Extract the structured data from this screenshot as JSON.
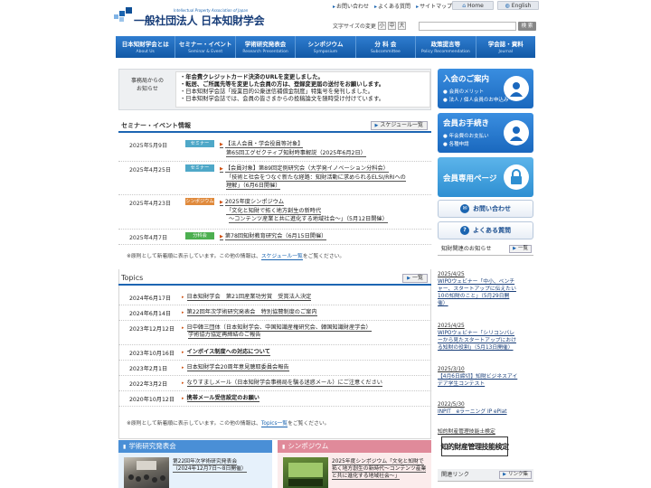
{
  "header": {
    "logo_main": "一般社団法人 日本知財学会",
    "logo_sub": "Intellectual Property Association of Japan",
    "toplinks": [
      "お問い合わせ",
      "よくある質問",
      "サイトマップ"
    ],
    "home_label": "Home",
    "english_label": "English",
    "font_size_label": "文字サイズの変更",
    "font_sizes": [
      "小",
      "中",
      "大"
    ],
    "search_placeholder": "",
    "search_button": "検 索"
  },
  "nav": [
    {
      "jp": "日本知財学会とは",
      "en": "About Us"
    },
    {
      "jp": "セミナー・イベント",
      "en": "Seminar & Event"
    },
    {
      "jp": "学術研究発表会",
      "en": "Research Presentation"
    },
    {
      "jp": "シンポジウム",
      "en": "Symposium"
    },
    {
      "jp": "分 科 会",
      "en": "Subcommittee"
    },
    {
      "jp": "政策提言等",
      "en": "Policy Recommendation"
    },
    {
      "jp": "学会誌・資料",
      "en": "Journal"
    }
  ],
  "notice": {
    "label_line1": "事務局からの",
    "label_line2": "お知らせ",
    "lines": [
      "・年会費クレジットカード決済のURLを変更しました。",
      "・転居、ご所属先等を変更した会員の方は、登録変更届の送付をお願いします。",
      "・日本知財学会誌「授業目的公衆送信補償金制度」特集号を発刊しました。",
      "・日本知財学会誌では、会員の皆さまからの投稿論文を随時受け付けています。"
    ]
  },
  "seminar": {
    "title": "セミナー・イベント情報",
    "list_label": "スケジュール一覧",
    "rows": [
      {
        "date": "2025年5月9日",
        "tag": "セミナー",
        "tag_color": "#4fa8c8",
        "lines": [
          "【法人会員・学会役員等対象】",
          "第65回エグゼクティブ知財時事解説（2025年6月2日）"
        ]
      },
      {
        "date": "2025年4月25日",
        "tag": "セミナー",
        "tag_color": "#4fa8c8",
        "lines": [
          "【会員対象】第89回定例研究会（大学発イノベーション分科会）",
          "「技術と社会をつなぐ新たな経路：知財活動に求められるELSI/RRIへの",
          "理解」（6月6日開催）"
        ]
      },
      {
        "date": "2025年4月23日",
        "tag": "シンポジウム",
        "tag_color": "#e08a3c",
        "lines": [
          "2025年度シンポジウム",
          "「文化と知財で拓く地方創生の新時代",
          "～コンテンツ産業と共に進化する地域社会～」（5月12日開催）"
        ]
      },
      {
        "date": "2025年4月7日",
        "tag": "分科会",
        "tag_color": "#4caf50",
        "lines": [
          "第78回知財教育研究会（6月15日開催）"
        ]
      }
    ],
    "note_pre": "※原則として新着順に表示しています。この他の情報は、",
    "note_link": "スケジュール一覧",
    "note_post": "をご覧ください。"
  },
  "topics": {
    "title": "Topics",
    "list_label": "一覧",
    "rows": [
      {
        "date": "2024年6月17日",
        "lines": [
          "日本知財学会　第21回産業功労賞　受賞法人決定"
        ],
        "bold": false
      },
      {
        "date": "2024年6月14日",
        "lines": [
          "第22回年次学術研究発表会　特別協賛制度のご案内"
        ],
        "bold": false
      },
      {
        "date": "2023年12月12日",
        "lines": [
          "日中韓三団体（日本知財学会、中国知識産権研究会、韓国知識財産学会）",
          "学術協力協定再締結のご報告"
        ],
        "bold": false
      },
      {
        "date": "2023年10月16日",
        "lines": [
          "インボイス制度への対応について"
        ],
        "bold": true
      },
      {
        "date": "2023年2月1日",
        "lines": [
          "日本知財学会20周年意見聴取委員会報告"
        ],
        "bold": false
      },
      {
        "date": "2022年3月2日",
        "lines": [
          "なりすましメール（日本知財学会事務局を騙る迷惑メール）にご注意ください"
        ],
        "bold": false
      },
      {
        "date": "2020年10月12日",
        "lines": [
          "携帯メール受信設定のお願い"
        ],
        "bold": true
      }
    ],
    "note_pre": "※原則として新着順に表示しています。この他の情報は、",
    "note_link": "Topics一覧",
    "note_post": "をご覧ください。"
  },
  "panels": {
    "research": {
      "title": "学術研究発表会",
      "color": "#4a8fd6",
      "text1": "第22回年次学術研究発表会",
      "text2": "（2024年12月7日～8日開催）"
    },
    "symposium": {
      "title": "シンポジウム",
      "color": "#e08a9a",
      "text1": "2025年度シンポジウム「文化と知財で",
      "text2": "拓く地方創生の新時代～コンテンツ産業",
      "text3": "と共に進化する地域社会～」"
    }
  },
  "right": {
    "join": {
      "title": "入会のご案内",
      "items": [
        "会員のメリット",
        "法人 / 個人会員のお申込み"
      ],
      "color": "#2a7fd0"
    },
    "procedures": {
      "title": "会員お手続き",
      "items": [
        "年会費のお支払い",
        "各種申請"
      ],
      "color": "#2a7fd0"
    },
    "members": {
      "title": "会員専用ページ",
      "color": "#3fa0d8"
    },
    "contact_label": "お問い合わせ",
    "faq_label": "よくある質問",
    "related_news": {
      "title": "知財関連のお知らせ",
      "list_label": "一覧",
      "items": [
        {
          "date": "2025/4/25",
          "lines": [
            "WIPOウェビナー「中小、ベンチ",
            "ャー、スタートアップに伝えたい",
            "10の知財のこと」（5月29日開",
            "催）"
          ]
        },
        {
          "date": "2025/4/25",
          "lines": [
            "WIPOウェビナー「シリコンバレ",
            "ーから見たスタートアップにおけ",
            "る知財の役割」（5月13日開催）"
          ]
        },
        {
          "date": "2025/3/10",
          "lines": [
            "【4月6日締切】知財ビジネスアイ",
            "デア学生コンテスト"
          ]
        },
        {
          "date": "2022/5/30",
          "lines": [
            "INPIT　eラーニング IP ePlat"
          ]
        }
      ]
    },
    "cert_label": "知的財産管理技能士検定",
    "cert_image_text": "知的財産管理技能検定",
    "links_title": "関連リンク",
    "links_list_label": "リンク集"
  }
}
